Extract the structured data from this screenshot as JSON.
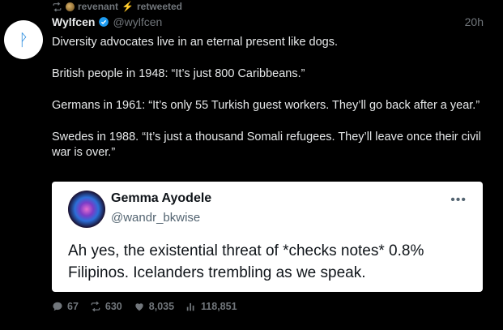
{
  "retweet": {
    "user": "revenant",
    "emoji": "⚡",
    "label": "retweeted"
  },
  "tweet": {
    "display_name": "Wylfcen",
    "handle": "@wylfcen",
    "time": "20h",
    "avatar_glyph": "ᚹ",
    "paragraphs": [
      "Diversity advocates live in an eternal present like dogs.",
      "British people in 1948: “It’s just 800 Caribbeans.”",
      "Germans in 1961: “It’s only 55 Turkish guest workers. They’ll go back after a year.”",
      "Swedes in 1988. “It’s just a thousand Somali refugees. They’ll leave once their civil war is over.”"
    ]
  },
  "quote": {
    "display_name": "Gemma Ayodele",
    "handle": "@wandr_bkwise",
    "more": "•••",
    "text": "Ah yes, the existential threat of *checks notes* 0.8% Filipinos. Icelanders trembling as we speak."
  },
  "actions": {
    "replies": "67",
    "retweets": "630",
    "likes": "8,035",
    "views": "118,851"
  },
  "colors": {
    "background": "#000000",
    "text": "#e7e9ea",
    "muted": "#71767b",
    "verified": "#1d9bf0"
  },
  "icons": [
    "retweet-icon",
    "verified-badge-icon",
    "reply-icon",
    "like-icon",
    "views-icon",
    "more-icon"
  ]
}
